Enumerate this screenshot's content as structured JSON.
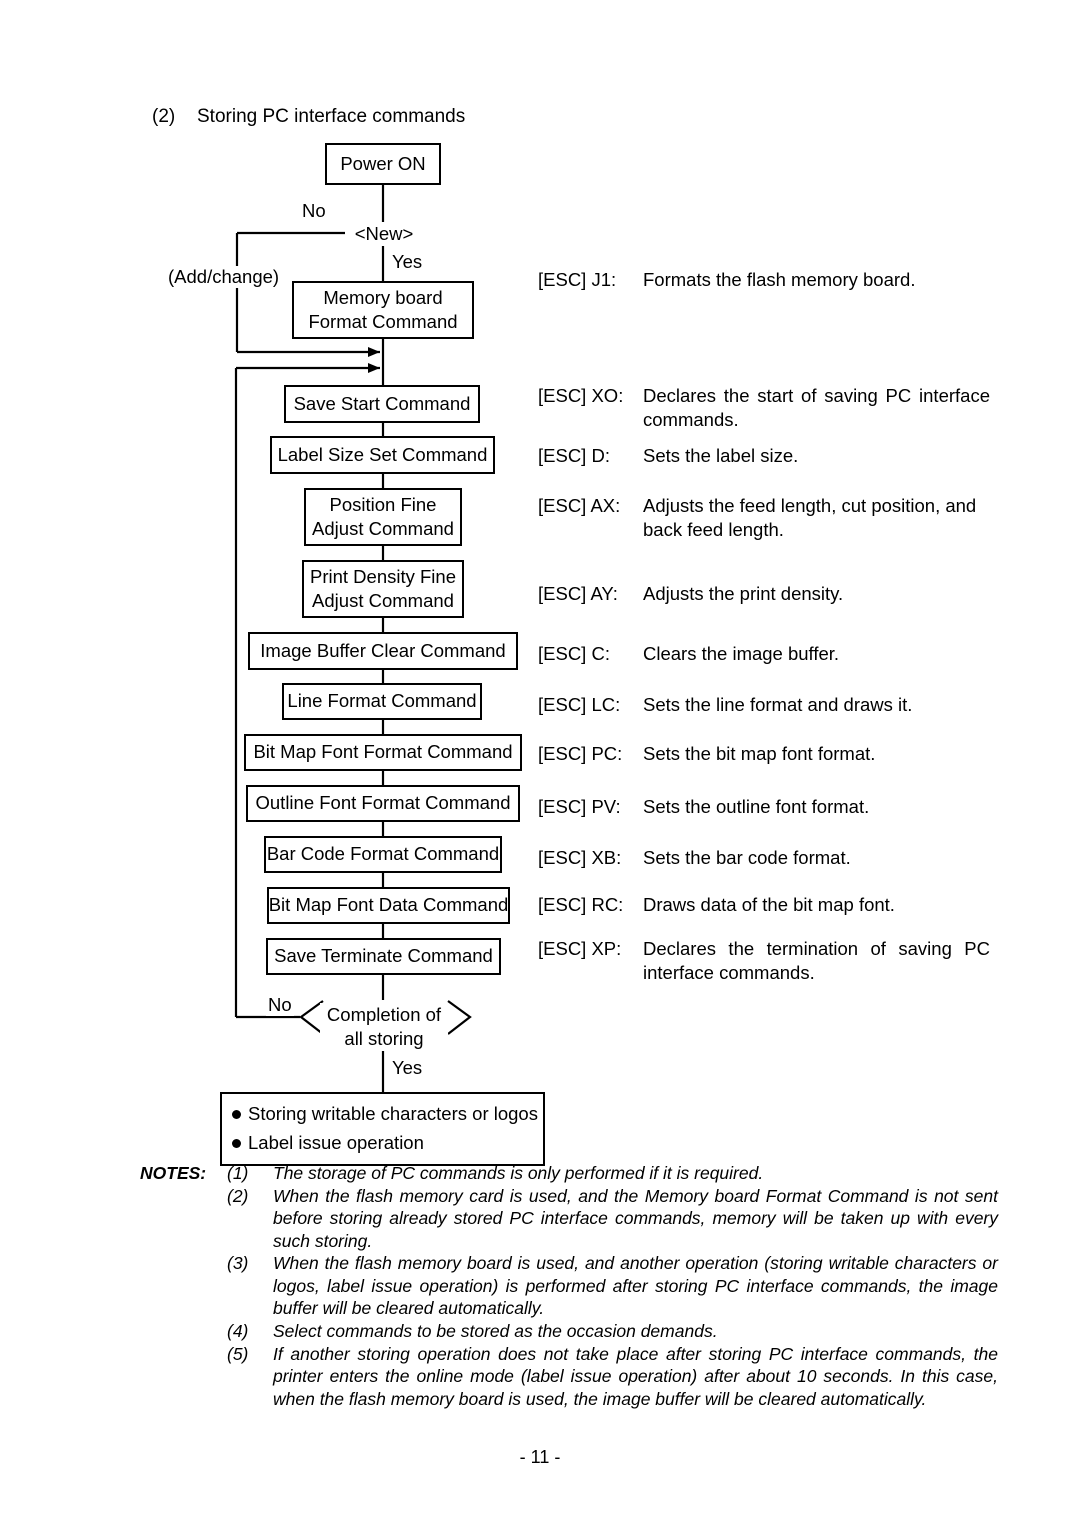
{
  "section": {
    "number": "(2)",
    "title": "Storing PC interface commands"
  },
  "flowchart": {
    "power_on": "Power ON",
    "decision_new": "<New>",
    "label_no_top": "No",
    "label_yes_top": "Yes",
    "label_add_change": "(Add/change)",
    "memory_board_line1": "Memory board",
    "memory_board_line2": "Format Command",
    "save_start": "Save Start Command",
    "label_size_set": "Label Size Set Command",
    "position_fine_line1": "Position Fine",
    "position_fine_line2": "Adjust Command",
    "print_density_line1": "Print Density Fine",
    "print_density_line2": "Adjust Command",
    "image_buffer_clear": "Image Buffer Clear Command",
    "line_format": "Line Format Command",
    "bitmap_font_format": "Bit Map Font Format Command",
    "outline_font_format": "Outline Font Format Command",
    "bar_code_format": "Bar Code Format Command",
    "bitmap_font_data": "Bit Map Font Data Command",
    "save_terminate": "Save Terminate Command",
    "completion_line1": "Completion of",
    "completion_line2": "all storing",
    "label_no_bottom": "No",
    "label_yes_bottom": "Yes",
    "final_bullet_1": "Storing writable characters or logos",
    "final_bullet_2": "Label issue operation"
  },
  "esc_commands": [
    {
      "code": "[ESC] J1:",
      "desc": "Formats the flash memory board.",
      "justify": false
    },
    {
      "code": "[ESC] XO:",
      "desc": "Declares the start of saving PC interface commands.",
      "justify": true
    },
    {
      "code": "[ESC] D:",
      "desc": "Sets the label size.",
      "justify": false
    },
    {
      "code": "[ESC] AX:",
      "desc": "Adjusts the feed length, cut position, and back feed length.",
      "justify": false
    },
    {
      "code": "[ESC] AY:",
      "desc": "Adjusts the print density.",
      "justify": false
    },
    {
      "code": "[ESC] C:",
      "desc": "Clears the image buffer.",
      "justify": false
    },
    {
      "code": "[ESC] LC:",
      "desc": "Sets the line format and draws it.",
      "justify": false
    },
    {
      "code": "[ESC] PC:",
      "desc": "Sets the bit map font format.",
      "justify": false
    },
    {
      "code": "[ESC] PV:",
      "desc": "Sets the outline font format.",
      "justify": false
    },
    {
      "code": "[ESC] XB:",
      "desc": "Sets the bar code format.",
      "justify": false
    },
    {
      "code": "[ESC] RC:",
      "desc": "Draws data of the bit map font.",
      "justify": false
    },
    {
      "code": "[ESC] XP:",
      "desc": "Declares the termination of saving PC interface commands.",
      "justify": true
    }
  ],
  "notes": {
    "heading": "NOTES:",
    "items": [
      {
        "num": "(1)",
        "text": "The storage of PC commands is only performed if it is required."
      },
      {
        "num": "(2)",
        "text": "When the flash memory card is used, and the Memory board Format Command is not sent before storing already stored PC interface commands, memory will be taken up with every such storing."
      },
      {
        "num": "(3)",
        "text": "When the flash memory board is used, and another operation (storing writable characters or logos, label issue operation) is performed after storing PC interface commands, the image buffer will be cleared automatically."
      },
      {
        "num": "(4)",
        "text": "Select commands to be stored as the occasion demands."
      },
      {
        "num": "(5)",
        "text": "If another storing operation does not take place after storing PC interface commands, the printer enters the online mode (label issue operation) after about 10 seconds.  In this case, when the flash memory board is used, the image buffer will be cleared automatically."
      }
    ]
  },
  "footer": {
    "page_number": "- 11 -"
  }
}
